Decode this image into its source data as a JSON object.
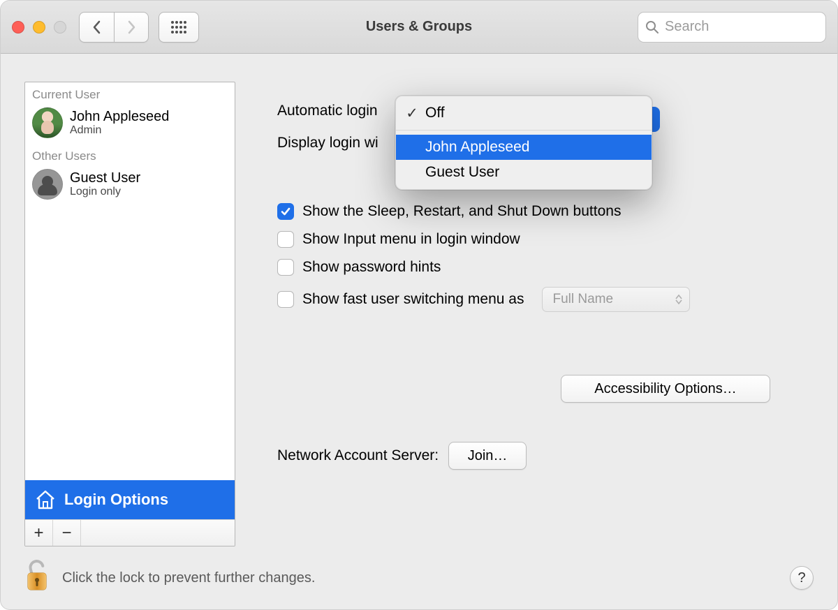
{
  "window": {
    "title": "Users & Groups"
  },
  "search": {
    "placeholder": "Search"
  },
  "sidebar": {
    "current_label": "Current User",
    "other_label": "Other Users",
    "current_user": {
      "name": "John Appleseed",
      "role": "Admin"
    },
    "other_user": {
      "name": "Guest User",
      "role": "Login only"
    },
    "login_options_label": "Login Options"
  },
  "main": {
    "auto_login_label": "Automatic login",
    "display_login_label_partial": "Display login wi",
    "checkboxes": {
      "sleep": {
        "label": "Show the Sleep, Restart, and Shut Down buttons",
        "checked": true
      },
      "input": {
        "label": "Show Input menu in login window",
        "checked": false
      },
      "hints": {
        "label": "Show password hints",
        "checked": false
      },
      "fastswitch": {
        "label": "Show fast user switching menu as",
        "checked": false
      }
    },
    "fastswitch_select_value": "Full Name",
    "accessibility_btn": "Accessibility Options…",
    "network_label": "Network Account Server:",
    "join_btn": "Join…"
  },
  "popup": {
    "items": [
      {
        "label": "Off",
        "checked": true,
        "highlighted": false
      },
      {
        "label": "John Appleseed",
        "checked": false,
        "highlighted": true
      },
      {
        "label": "Guest User",
        "checked": false,
        "highlighted": false
      }
    ]
  },
  "bottom": {
    "lock_text": "Click the lock to prevent further changes.",
    "help": "?"
  }
}
